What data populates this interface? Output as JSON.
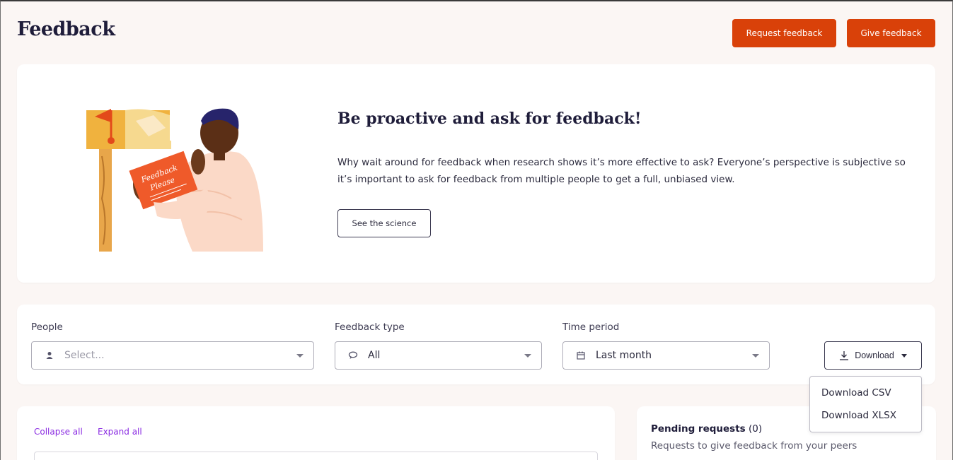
{
  "header": {
    "title": "Feedback",
    "request_button": "Request feedback",
    "give_button": "Give feedback"
  },
  "hero": {
    "illustration": "mailbox-person-illustration",
    "card_text_line1": "Feedback",
    "card_text_line2": "Please",
    "title": "Be proactive and ask for feedback!",
    "body": "Why wait around for feedback when research shows it’s more effective to ask? Everyone’s perspective is subjective so it’s important to ask for feedback from multiple people to get a full, unbiased view.",
    "science_button": "See the science"
  },
  "filters": {
    "people": {
      "label": "People",
      "placeholder": "Select...",
      "icon": "person-icon"
    },
    "feedback_type": {
      "label": "Feedback type",
      "value": "All",
      "icon": "chat-bubble-icon"
    },
    "time_period": {
      "label": "Time period",
      "value": "Last month",
      "icon": "calendar-icon"
    },
    "download_button": "Download"
  },
  "download_menu": {
    "items": [
      "Download CSV",
      "Download XLSX"
    ]
  },
  "list": {
    "collapse_all": "Collapse all",
    "expand_all": "Expand all"
  },
  "pending": {
    "title": "Pending requests",
    "count": "(0)",
    "subtitle": "Requests to give feedback from your peers"
  },
  "colors": {
    "accent": "#d94109",
    "background": "#fbf6f4",
    "link": "#8a2be2",
    "heading": "#1f1d3a"
  }
}
